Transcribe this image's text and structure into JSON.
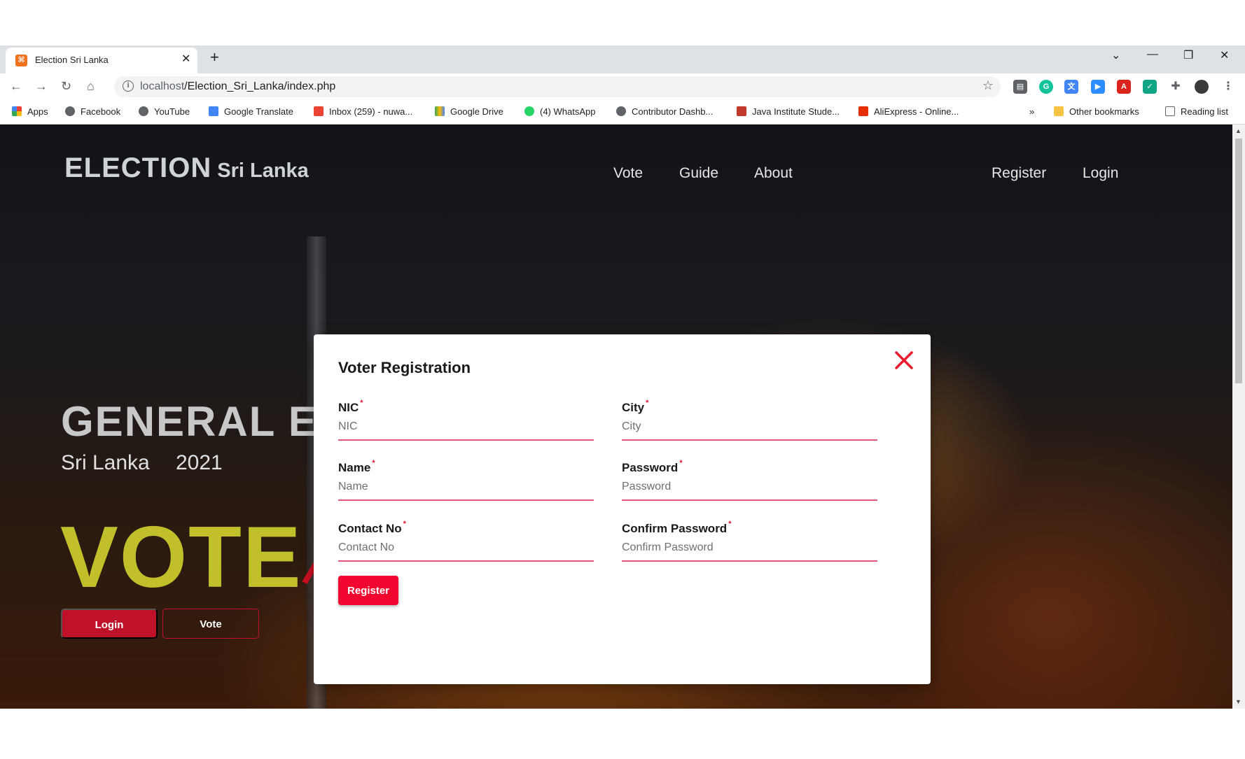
{
  "browser": {
    "tab_title": "Election Sri Lanka",
    "favicon_letter": "⌘",
    "url_host": "localhost",
    "url_path": "/Election_Sri_Lanka/index.php",
    "bookmarks": [
      "Apps",
      "Facebook",
      "YouTube",
      "Google Translate",
      "Inbox (259) - nuwa...",
      "Google Drive",
      "(4) WhatsApp",
      "Contributor Dashb...",
      "Java Institute Stude...",
      "AliExpress - Online..."
    ],
    "overflow": "»",
    "other_bookmarks": "Other bookmarks",
    "reading_list": "Reading list"
  },
  "site": {
    "brand_big": "ELECTION",
    "brand_small": "Sri Lanka",
    "nav": [
      "Vote",
      "Guide",
      "About"
    ],
    "auth": [
      "Register",
      "Login"
    ],
    "hero_title": "GENERAL ELI",
    "hero_country": "Sri Lanka",
    "hero_year": "2021",
    "vote_word": "VOTE",
    "login_btn": "Login",
    "vote_btn": "Vote"
  },
  "modal": {
    "title": "Voter Registration",
    "fields": [
      {
        "label": "NIC",
        "placeholder": "NIC"
      },
      {
        "label": "City",
        "placeholder": "City"
      },
      {
        "label": "Name",
        "placeholder": "Name"
      },
      {
        "label": "Password",
        "placeholder": "Password"
      },
      {
        "label": "Contact No",
        "placeholder": "Contact No"
      },
      {
        "label": "Confirm Password",
        "placeholder": "Confirm Password"
      }
    ],
    "required_mark": "*",
    "submit": "Register"
  },
  "colors": {
    "accent": "#f0062e",
    "vote_yellow": "#c2c02a",
    "underline": "#e8557a"
  }
}
